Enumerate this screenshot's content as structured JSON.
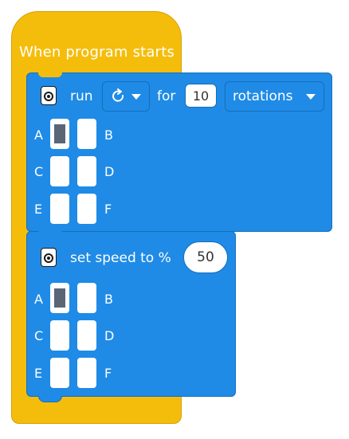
{
  "event_block": {
    "title": "When program starts"
  },
  "run_block": {
    "run_label": "run",
    "direction_dropdown": {
      "icon": "clockwise-rotate-icon"
    },
    "for_label": "for",
    "amount_value": "10",
    "unit_dropdown": {
      "value": "rotations"
    },
    "ports": [
      {
        "left": "A",
        "right": "B",
        "active": true
      },
      {
        "left": "C",
        "right": "D",
        "active": false
      },
      {
        "left": "E",
        "right": "F",
        "active": false
      }
    ]
  },
  "speed_block": {
    "label": "set speed to %",
    "speed_value": "50",
    "ports": [
      {
        "left": "A",
        "right": "B",
        "active": true
      },
      {
        "left": "C",
        "right": "D",
        "active": false
      },
      {
        "left": "E",
        "right": "F",
        "active": false
      }
    ]
  },
  "colors": {
    "event_yellow": "#f5bd0b",
    "motor_blue": "#1f8be6",
    "port_active_gray": "#5a6676"
  }
}
